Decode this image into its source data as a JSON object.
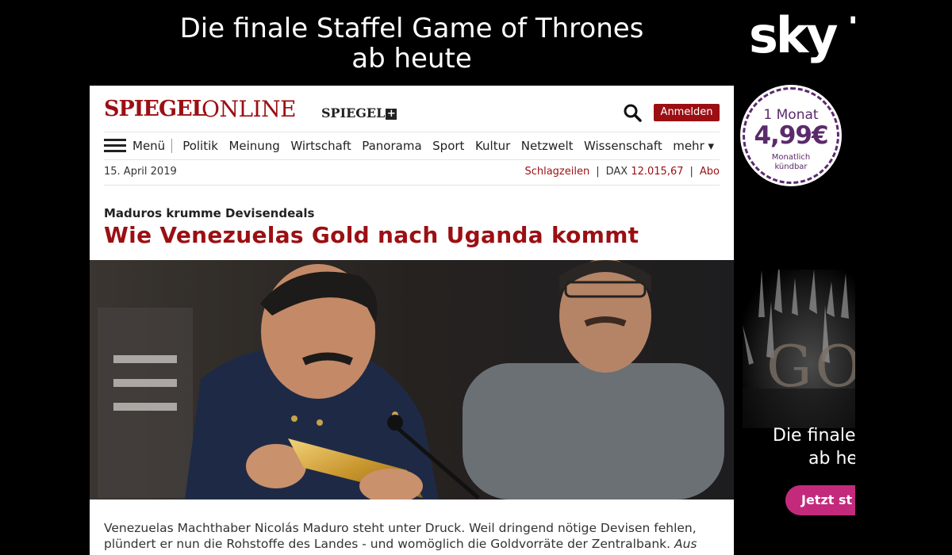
{
  "top_ad": {
    "line1": "Die finale Staffel Game of Thrones",
    "line2": "ab heute"
  },
  "side_ad": {
    "logo": "sky T",
    "badge_month": "1 Monat",
    "badge_price": "4,99€",
    "badge_note_line1": "Monatlich",
    "badge_note_line2": "kündbar",
    "watermark": "GO",
    "final_line1": "Die finale",
    "final_line2": "ab he",
    "cta": "Jetzt st",
    "brand_color": "#c42a7c",
    "badge_color": "#5b2a6b"
  },
  "header": {
    "logo_spiegel": "SPIEGEL",
    "logo_online": "ONLINE",
    "logo_plus": "SPIEGEL",
    "login_label": "Anmelden",
    "accent_color": "#9b0f13"
  },
  "nav": {
    "menu_label": "Menü",
    "items": [
      "Politik",
      "Meinung",
      "Wirtschaft",
      "Panorama",
      "Sport",
      "Kultur",
      "Netzwelt",
      "Wissenschaft"
    ],
    "more_label": "mehr ▾"
  },
  "dateline": {
    "date": "15. April 2019",
    "headlines_link": "Schlagzeilen",
    "dax_label": "DAX",
    "dax_value": "12.015,67",
    "abo_link": "Abo"
  },
  "article": {
    "kicker": "Maduros krumme Devisendeals",
    "headline": "Wie Venezuelas Gold nach Uganda kommt",
    "teaser_line1": "Venezuelas Machthaber Nicolás Maduro steht unter Druck. Weil dringend nötige Devisen fehlen,",
    "teaser_line2": "plündert er nun die Rohstoffe des Landes - und womöglich die Goldvorräte der Zentralbank.",
    "teaser_italic": "Aus"
  }
}
